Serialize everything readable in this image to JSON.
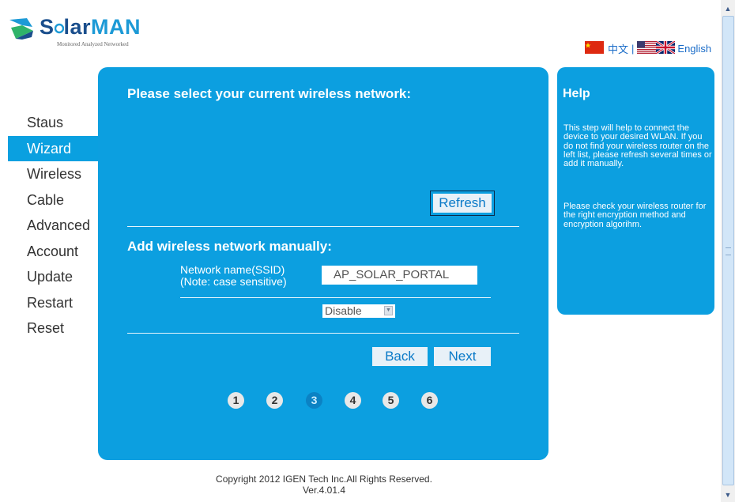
{
  "brand": {
    "name_part1": "S",
    "name_part2": "lar",
    "name_part3": "MAN",
    "tagline": "Monitored Analyzed Networked"
  },
  "language": {
    "chinese": "中文",
    "separator": "|",
    "english": "English"
  },
  "nav": {
    "items": [
      {
        "label": "Staus"
      },
      {
        "label": "Wizard"
      },
      {
        "label": "Wireless"
      },
      {
        "label": "Cable"
      },
      {
        "label": "Advanced"
      },
      {
        "label": "Account"
      },
      {
        "label": "Update"
      },
      {
        "label": "Restart"
      },
      {
        "label": "Reset"
      }
    ],
    "active": "Wizard"
  },
  "main": {
    "select_heading": "Please select your current wireless network:",
    "refresh_label": "Refresh",
    "add_heading": "Add wireless network manually:",
    "ssid_label_line1": "Network name(SSID)",
    "ssid_label_line2": "(Note: case sensitive)",
    "ssid_value": "AP_SOLAR_PORTAL",
    "encryption_value": "Disable",
    "back_label": "Back",
    "next_label": "Next",
    "steps": [
      "1",
      "2",
      "3",
      "4",
      "5",
      "6"
    ],
    "current_step": 3
  },
  "help": {
    "title": "Help",
    "paragraph1": "This step will help to connect the device to your desired WLAN. If you do not find your wireless router on the left list, please refresh several times or add it manually.",
    "paragraph2": "Please check your wireless router for the right encryption method and encryption algorihm."
  },
  "footer": {
    "copyright": "Copyright  2012 IGEN Tech Inc.All Rights Reserved.",
    "version": "Ver.4.01.4"
  },
  "colors": {
    "panel": "#0c9fe0",
    "active_nav": "#0aa0e0",
    "brand_light": "#1d9ad6",
    "brand_dark": "#1a4e8c"
  }
}
